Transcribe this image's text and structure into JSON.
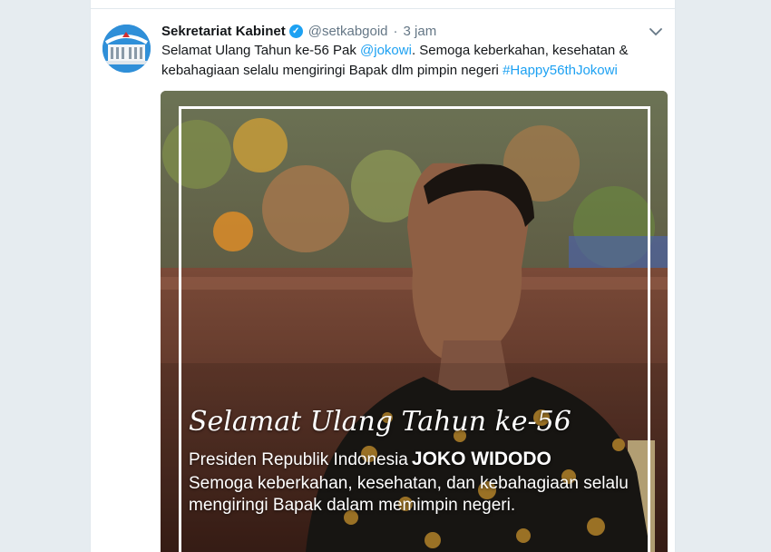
{
  "tweet": {
    "author_name": "Sekretariat Kabinet",
    "verified": true,
    "handle": "@setkabgoid",
    "separator": "·",
    "time": "3 jam",
    "text_before": "Selamat Ulang Tahun ke-56 Pak ",
    "mention": "@jokowi",
    "text_middle": ". Semoga keberkahan, kesehatan & kebahagiaan selalu mengiringi Bapak dlm pimpin negeri ",
    "hashtag": "#Happy56thJokowi",
    "avatar_icon": "sekretariat-kabinet-logo",
    "menu_icon": "chevron-down-icon"
  },
  "media": {
    "title": "Selamat Ulang Tahun ke-56",
    "subtitle": "Presiden Republik Indonesia",
    "name": "JOKO WIDODO",
    "message": "Semoga keberkahan, kesehatan, dan kebahagiaan selalu mengiringi Bapak dalam memimpin negeri."
  },
  "colors": {
    "link": "#1da1f2",
    "background": "#e6ecf0",
    "text": "#14171a",
    "muted": "#657786"
  }
}
